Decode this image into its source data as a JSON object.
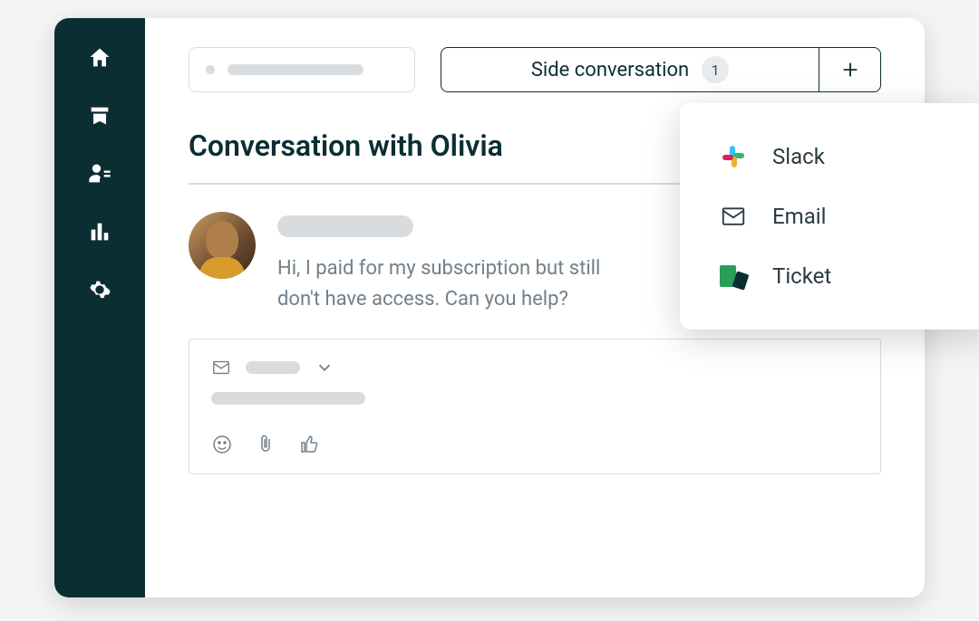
{
  "sidebar": {
    "items": [
      {
        "name": "home-icon"
      },
      {
        "name": "views-icon"
      },
      {
        "name": "customers-icon"
      },
      {
        "name": "reporting-icon"
      },
      {
        "name": "settings-icon"
      }
    ]
  },
  "header": {
    "side_conversation_label": "Side conversation",
    "side_conversation_count": "1"
  },
  "page_title": "Conversation with Olivia",
  "message": {
    "text": "Hi, I paid for my subscription but still don't have access. Can you help?"
  },
  "dropdown": {
    "options": [
      {
        "label": "Slack",
        "icon": "slack-icon"
      },
      {
        "label": "Email",
        "icon": "email-icon"
      },
      {
        "label": "Ticket",
        "icon": "ticket-icon"
      }
    ]
  }
}
